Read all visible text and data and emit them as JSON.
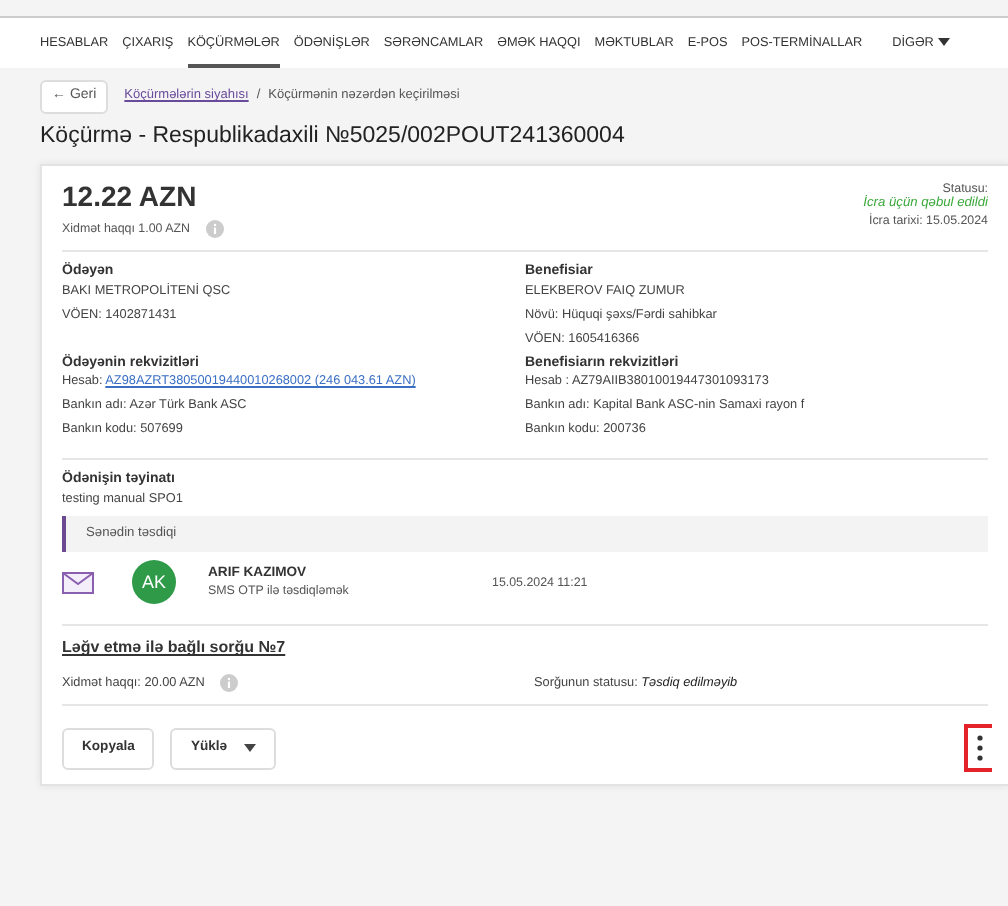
{
  "nav": {
    "items": [
      {
        "label": "HESABLAR",
        "selected": false
      },
      {
        "label": "ÇIXARIŞ",
        "selected": false
      },
      {
        "label": "KÖÇÜRMƏLƏR",
        "selected": true
      },
      {
        "label": "ÖDƏNİŞLƏR",
        "selected": false
      },
      {
        "label": "SƏRƏNCAMLAR",
        "selected": false
      },
      {
        "label": "ƏMƏK HAQQI",
        "selected": false
      },
      {
        "label": "MƏKTUBLAR",
        "selected": false
      },
      {
        "label": "E-POS",
        "selected": false
      },
      {
        "label": "POS-TERMİNALLAR",
        "selected": false
      }
    ],
    "more": "DİGƏR"
  },
  "breadcrumb": {
    "back": "← Geri",
    "link": "Köçürmələrin siyahısı",
    "separator": "/",
    "current": "Köçürmənin nəzərdən keçirilməsi"
  },
  "title": "Köçürmə - Respublikadaxili №5025/002POUT241360004",
  "summary": {
    "amount": "12.22 AZN",
    "fee": "Xidmət haqqı 1.00 AZN",
    "status_label": "Statusu:",
    "status": "İcra üçün qəbul edildi",
    "execution_date": "İcra tarixi: 15.05.2024"
  },
  "parties": [
    {
      "heading": "Ödəyən",
      "lines": [
        "BAKI METROPOLİTENİ QSC",
        "VÖEN: 1402871431"
      ]
    },
    {
      "heading": "Benefisiar",
      "lines": [
        "ELEKBEROV FAIQ ZUMUR",
        "Növü: Hüquqi şəxs/Fərdi sahibkar",
        "VÖEN: 1605416366"
      ]
    }
  ],
  "requisites": [
    {
      "heading": "Ödəyənin rekvizitləri",
      "lines": [
        {
          "label": "Hesab:",
          "value": "AZ98AZRT38050019440010268002 (246 043.61 AZN)",
          "link": true
        },
        {
          "label": "Bankın adı:",
          "value": "Azər Türk Bank ASC",
          "link": false
        },
        {
          "label": "Bankın kodu:",
          "value": "507699",
          "link": false
        }
      ]
    },
    {
      "heading": "Benefisiarın rekvizitləri",
      "lines": [
        {
          "label": "Hesab :",
          "value": "AZ79AIIB38010019447301093173",
          "link": false
        },
        {
          "label": "Bankın adı:",
          "value": "Kapital Bank ASC-nin Samaxi rayon f",
          "link": false
        },
        {
          "label": "Bankın kodu:",
          "value": "200736",
          "link": false
        }
      ]
    }
  ],
  "purpose": {
    "heading": "Ödənişin təyinatı",
    "text": "testing manual SPO1"
  },
  "approval": {
    "heading": "Sənədin təsdiqi",
    "entries": [
      {
        "initials": "AK",
        "name": "ARIF KAZIMOV",
        "method": "SMS OTP ilə təsdiqləmək",
        "time": "15.05.2024 11:21"
      }
    ]
  },
  "cancel_request": {
    "title": "Ləğv etmə ilə bağlı sorğu №7",
    "fee": "Xidmət haqqı: 20.00 AZN",
    "status_label": "Sorğunun statusu:",
    "status": "Təsdiq edilməyib"
  },
  "actions": {
    "buttons": [
      {
        "label": "Kopyala",
        "kind": "plain"
      },
      {
        "label": "Yüklə",
        "kind": "dropdown"
      }
    ],
    "more_highlighted": true
  }
}
